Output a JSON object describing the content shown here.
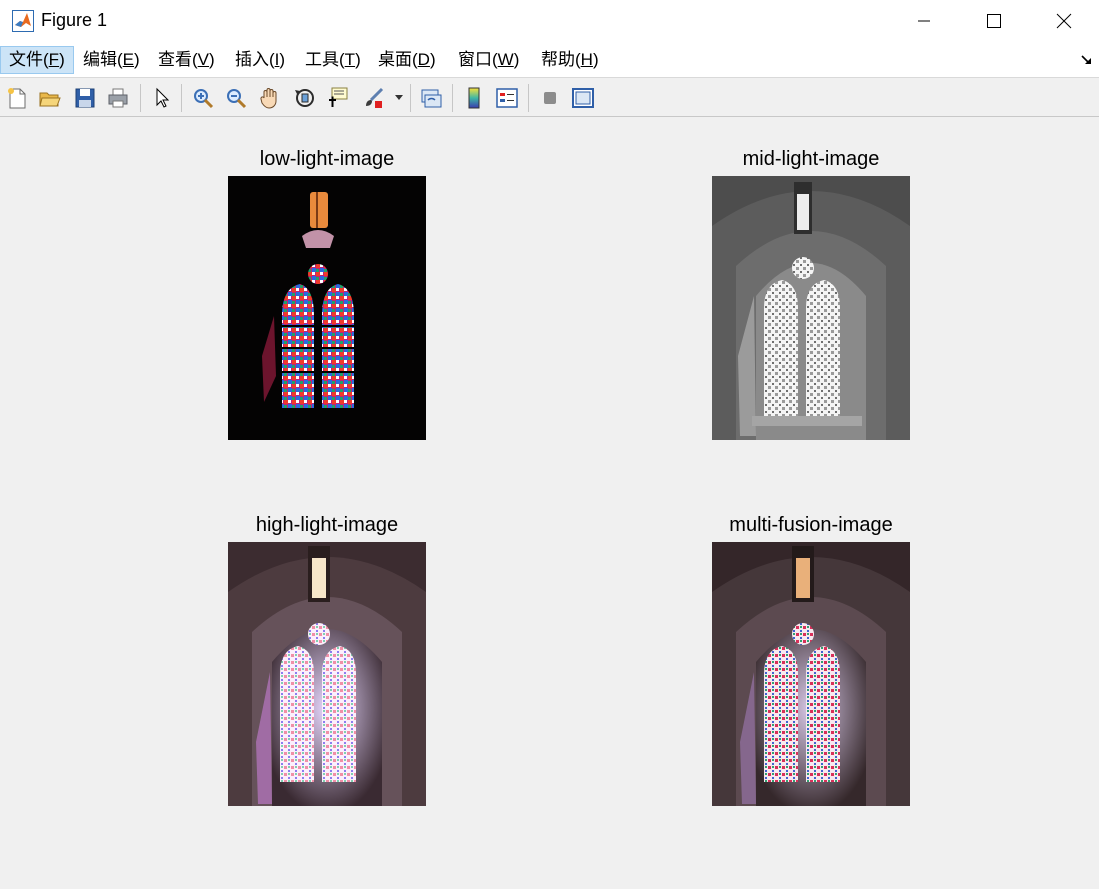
{
  "window": {
    "title": "Figure 1"
  },
  "menu": [
    {
      "label": "文件(",
      "key": "F",
      "suffix": ")"
    },
    {
      "label": "编辑(",
      "key": "E",
      "suffix": ")"
    },
    {
      "label": "查看(",
      "key": "V",
      "suffix": ")"
    },
    {
      "label": "插入(",
      "key": "I",
      "suffix": ")"
    },
    {
      "label": "工具(",
      "key": "T",
      "suffix": ")"
    },
    {
      "label": "桌面(",
      "key": "D",
      "suffix": ")"
    },
    {
      "label": "窗口(",
      "key": "W",
      "suffix": ")"
    },
    {
      "label": "帮助(",
      "key": "H",
      "suffix": ")"
    }
  ],
  "toolbar": {
    "icons": [
      "new-figure-icon",
      "open-file-icon",
      "save-icon",
      "print-icon",
      "edit-plot-arrow-icon",
      "zoom-in-icon",
      "zoom-out-icon",
      "pan-hand-icon",
      "rotate-3d-icon",
      "data-cursor-icon",
      "brush-icon",
      "brush-dropdown-icon",
      "link-plot-icon",
      "colorbar-icon",
      "legend-icon",
      "hide-plot-tools-icon",
      "show-plot-tools-icon"
    ]
  },
  "subplots": [
    {
      "title": "low-light-image",
      "exposure": "low"
    },
    {
      "title": "mid-light-image",
      "exposure": "mid"
    },
    {
      "title": "high-light-image",
      "exposure": "high"
    },
    {
      "title": "multi-fusion-image",
      "exposure": "fusion"
    }
  ],
  "colors": {
    "menu_active_bg": "#cce4f7",
    "figure_bg": "#f0f0f0"
  }
}
